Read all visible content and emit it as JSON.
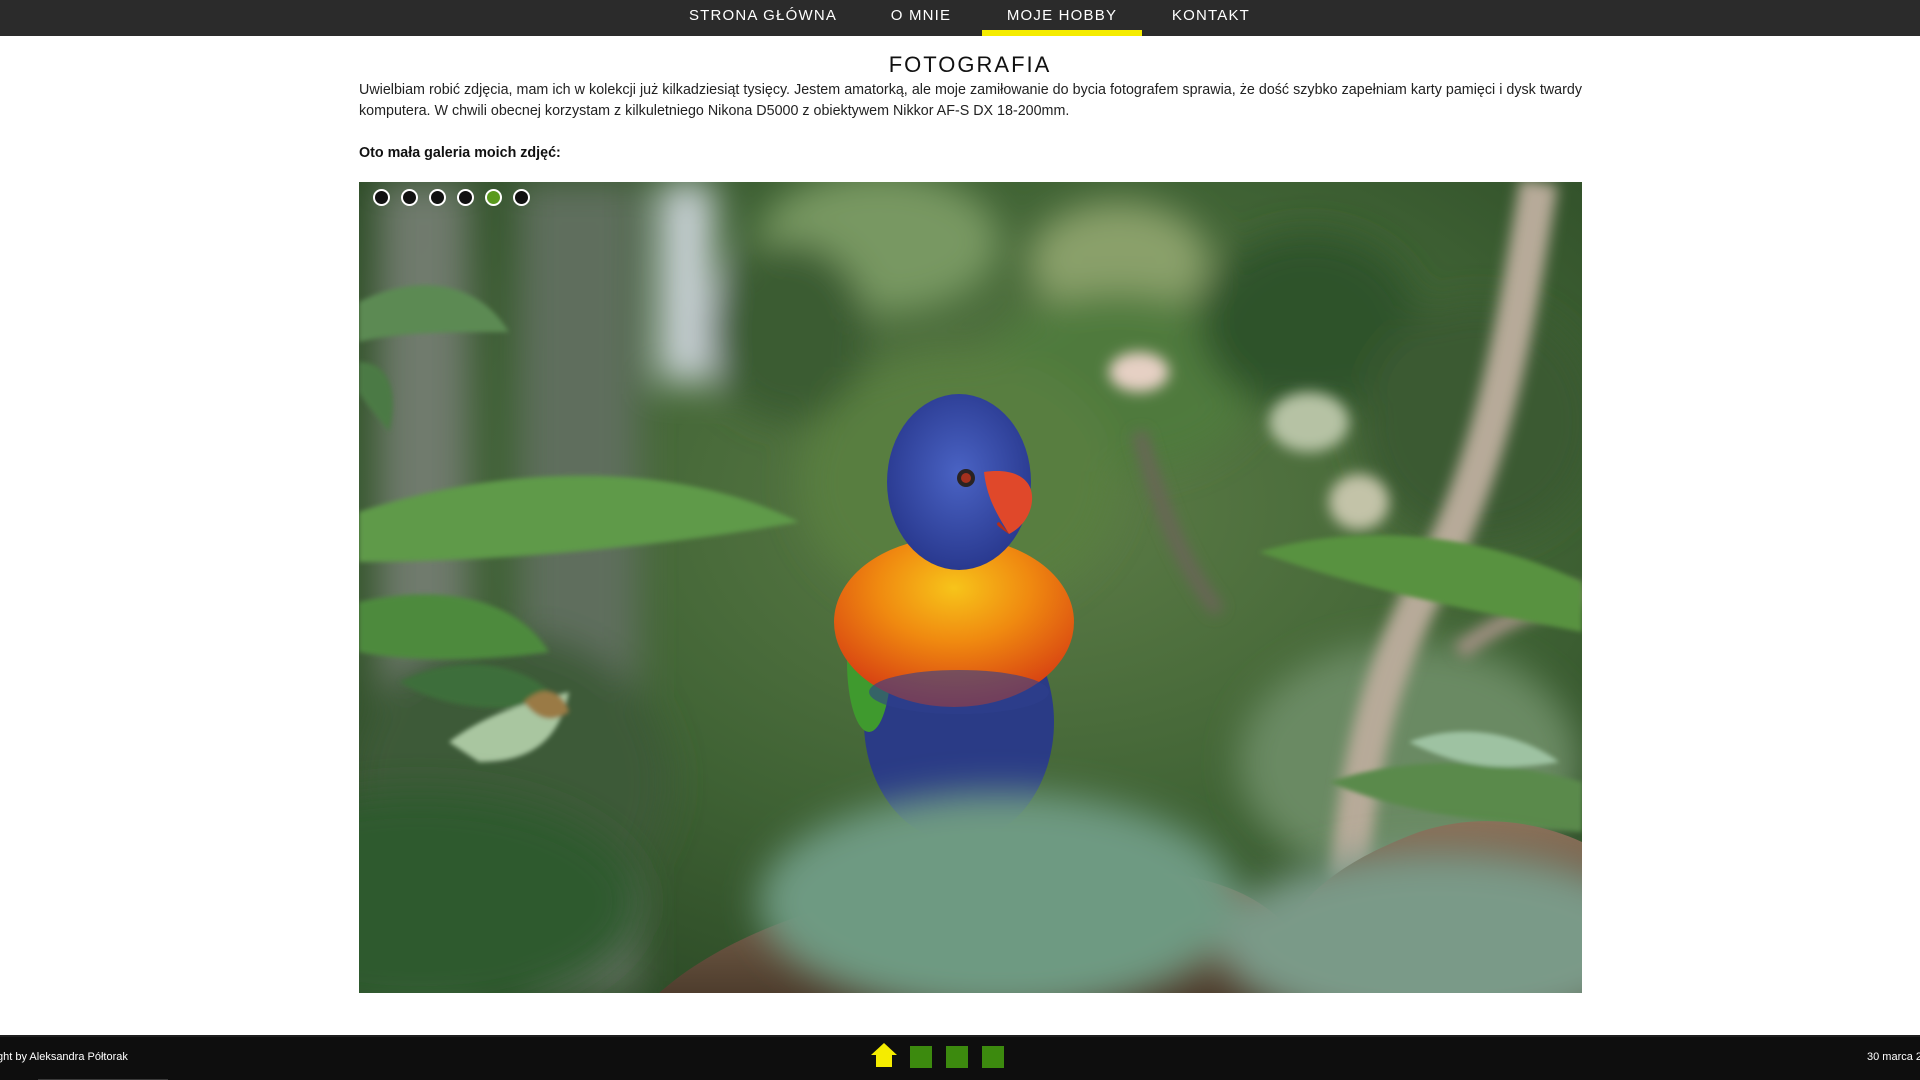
{
  "nav": {
    "items": [
      {
        "label": "STRONA GŁÓWNA"
      },
      {
        "label": "O MNIE"
      },
      {
        "label": "MOJE HOBBY",
        "active": true
      },
      {
        "label": "KONTAKT"
      }
    ],
    "active_underline_color": "#f5ec00"
  },
  "main": {
    "title": "FOTOGRAFIA",
    "intro": "Uwielbiam robić zdjęcia, mam ich w kolekcji już kilkadziesiąt tysięcy. Jestem amatorką, ale moje zamiłowanie do bycia fotografem sprawia, że dość szybko zapełniam karty pamięci i dysk twardy komputera. W chwili obecnej korzystam z kilkuletniego Nikona D5000 z obiektywem Nikkor AF-S DX 18-200mm.",
    "gallery_heading": "Oto mała galeria moich zdjęć:"
  },
  "gallery": {
    "slides": 6,
    "active_slide": 5,
    "active_dot_color": "#5a9a1e"
  },
  "footer": {
    "copyright": "ght by Aleksandra Półtorak",
    "date": "30 marca 2",
    "icons": [
      "home-icon",
      "square-icon",
      "square-icon",
      "square-icon"
    ],
    "home_icon_color": "#f5ec00",
    "square_color": "#3c8a0e"
  }
}
